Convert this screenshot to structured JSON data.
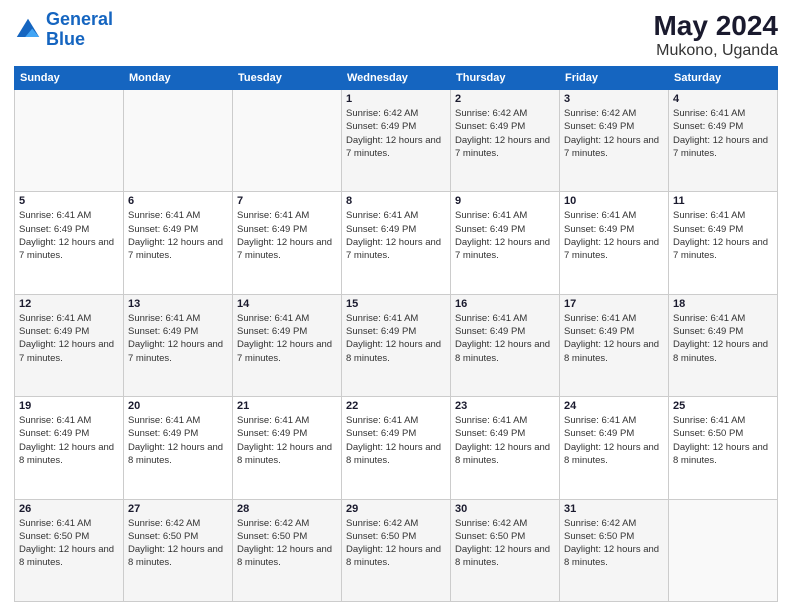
{
  "header": {
    "logo_line1": "General",
    "logo_line2": "Blue",
    "title": "May 2024",
    "subtitle": "Mukono, Uganda"
  },
  "weekdays": [
    "Sunday",
    "Monday",
    "Tuesday",
    "Wednesday",
    "Thursday",
    "Friday",
    "Saturday"
  ],
  "weeks": [
    [
      {
        "day": "",
        "info": ""
      },
      {
        "day": "",
        "info": ""
      },
      {
        "day": "",
        "info": ""
      },
      {
        "day": "1",
        "info": "Sunrise: 6:42 AM\nSunset: 6:49 PM\nDaylight: 12 hours\nand 7 minutes."
      },
      {
        "day": "2",
        "info": "Sunrise: 6:42 AM\nSunset: 6:49 PM\nDaylight: 12 hours\nand 7 minutes."
      },
      {
        "day": "3",
        "info": "Sunrise: 6:42 AM\nSunset: 6:49 PM\nDaylight: 12 hours\nand 7 minutes."
      },
      {
        "day": "4",
        "info": "Sunrise: 6:41 AM\nSunset: 6:49 PM\nDaylight: 12 hours\nand 7 minutes."
      }
    ],
    [
      {
        "day": "5",
        "info": "Sunrise: 6:41 AM\nSunset: 6:49 PM\nDaylight: 12 hours\nand 7 minutes."
      },
      {
        "day": "6",
        "info": "Sunrise: 6:41 AM\nSunset: 6:49 PM\nDaylight: 12 hours\nand 7 minutes."
      },
      {
        "day": "7",
        "info": "Sunrise: 6:41 AM\nSunset: 6:49 PM\nDaylight: 12 hours\nand 7 minutes."
      },
      {
        "day": "8",
        "info": "Sunrise: 6:41 AM\nSunset: 6:49 PM\nDaylight: 12 hours\nand 7 minutes."
      },
      {
        "day": "9",
        "info": "Sunrise: 6:41 AM\nSunset: 6:49 PM\nDaylight: 12 hours\nand 7 minutes."
      },
      {
        "day": "10",
        "info": "Sunrise: 6:41 AM\nSunset: 6:49 PM\nDaylight: 12 hours\nand 7 minutes."
      },
      {
        "day": "11",
        "info": "Sunrise: 6:41 AM\nSunset: 6:49 PM\nDaylight: 12 hours\nand 7 minutes."
      }
    ],
    [
      {
        "day": "12",
        "info": "Sunrise: 6:41 AM\nSunset: 6:49 PM\nDaylight: 12 hours\nand 7 minutes."
      },
      {
        "day": "13",
        "info": "Sunrise: 6:41 AM\nSunset: 6:49 PM\nDaylight: 12 hours\nand 7 minutes."
      },
      {
        "day": "14",
        "info": "Sunrise: 6:41 AM\nSunset: 6:49 PM\nDaylight: 12 hours\nand 7 minutes."
      },
      {
        "day": "15",
        "info": "Sunrise: 6:41 AM\nSunset: 6:49 PM\nDaylight: 12 hours\nand 8 minutes."
      },
      {
        "day": "16",
        "info": "Sunrise: 6:41 AM\nSunset: 6:49 PM\nDaylight: 12 hours\nand 8 minutes."
      },
      {
        "day": "17",
        "info": "Sunrise: 6:41 AM\nSunset: 6:49 PM\nDaylight: 12 hours\nand 8 minutes."
      },
      {
        "day": "18",
        "info": "Sunrise: 6:41 AM\nSunset: 6:49 PM\nDaylight: 12 hours\nand 8 minutes."
      }
    ],
    [
      {
        "day": "19",
        "info": "Sunrise: 6:41 AM\nSunset: 6:49 PM\nDaylight: 12 hours\nand 8 minutes."
      },
      {
        "day": "20",
        "info": "Sunrise: 6:41 AM\nSunset: 6:49 PM\nDaylight: 12 hours\nand 8 minutes."
      },
      {
        "day": "21",
        "info": "Sunrise: 6:41 AM\nSunset: 6:49 PM\nDaylight: 12 hours\nand 8 minutes."
      },
      {
        "day": "22",
        "info": "Sunrise: 6:41 AM\nSunset: 6:49 PM\nDaylight: 12 hours\nand 8 minutes."
      },
      {
        "day": "23",
        "info": "Sunrise: 6:41 AM\nSunset: 6:49 PM\nDaylight: 12 hours\nand 8 minutes."
      },
      {
        "day": "24",
        "info": "Sunrise: 6:41 AM\nSunset: 6:49 PM\nDaylight: 12 hours\nand 8 minutes."
      },
      {
        "day": "25",
        "info": "Sunrise: 6:41 AM\nSunset: 6:50 PM\nDaylight: 12 hours\nand 8 minutes."
      }
    ],
    [
      {
        "day": "26",
        "info": "Sunrise: 6:41 AM\nSunset: 6:50 PM\nDaylight: 12 hours\nand 8 minutes."
      },
      {
        "day": "27",
        "info": "Sunrise: 6:42 AM\nSunset: 6:50 PM\nDaylight: 12 hours\nand 8 minutes."
      },
      {
        "day": "28",
        "info": "Sunrise: 6:42 AM\nSunset: 6:50 PM\nDaylight: 12 hours\nand 8 minutes."
      },
      {
        "day": "29",
        "info": "Sunrise: 6:42 AM\nSunset: 6:50 PM\nDaylight: 12 hours\nand 8 minutes."
      },
      {
        "day": "30",
        "info": "Sunrise: 6:42 AM\nSunset: 6:50 PM\nDaylight: 12 hours\nand 8 minutes."
      },
      {
        "day": "31",
        "info": "Sunrise: 6:42 AM\nSunset: 6:50 PM\nDaylight: 12 hours\nand 8 minutes."
      },
      {
        "day": "",
        "info": ""
      }
    ]
  ]
}
